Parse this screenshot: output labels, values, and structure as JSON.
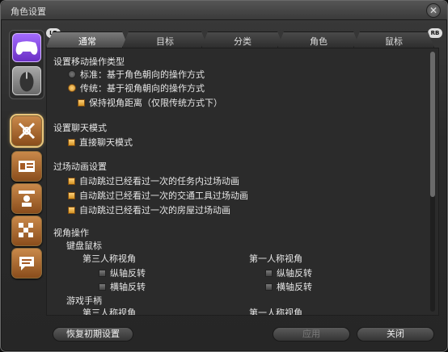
{
  "window": {
    "title": "角色设置",
    "close_icon": "close-icon"
  },
  "bumpers": {
    "left": "LB",
    "right": "RB"
  },
  "tabs": [
    {
      "label": "通常",
      "active": true
    },
    {
      "label": "目标",
      "active": false
    },
    {
      "label": "分类",
      "active": false
    },
    {
      "label": "角色",
      "active": false
    },
    {
      "label": "鼠标",
      "active": false
    }
  ],
  "sections": {
    "move_type": {
      "title": "设置移动操作类型",
      "standard": "标准：基于角色朝向的操作方式",
      "legacy": "传统：基于视角朝向的操作方式",
      "keep_distance": "保持视角距离（仅限传统方式下）"
    },
    "chat": {
      "title": "设置聊天模式",
      "direct": "直接聊天模式"
    },
    "cutscene": {
      "title": "过场动画设置",
      "skip1": "自动跳过已经看过一次的任务内过场动画",
      "skip2": "自动跳过已经看过一次的交通工具过场动画",
      "skip3": "自动跳过已经看过一次的房屋过场动画"
    },
    "camera": {
      "title": "视角操作",
      "keyboard": "键盘鼠标",
      "third_person": "第三人称视角",
      "first_person": "第一人称视角",
      "invert_y": "纵轴反转",
      "invert_x": "横轴反转",
      "gamepad": "游戏手柄",
      "third_person_gp": "第三人称视角",
      "first_person_gp": "第一人称视角"
    }
  },
  "buttons": {
    "reset": "恢复初期设置",
    "apply": "应用",
    "close": "关闭"
  }
}
